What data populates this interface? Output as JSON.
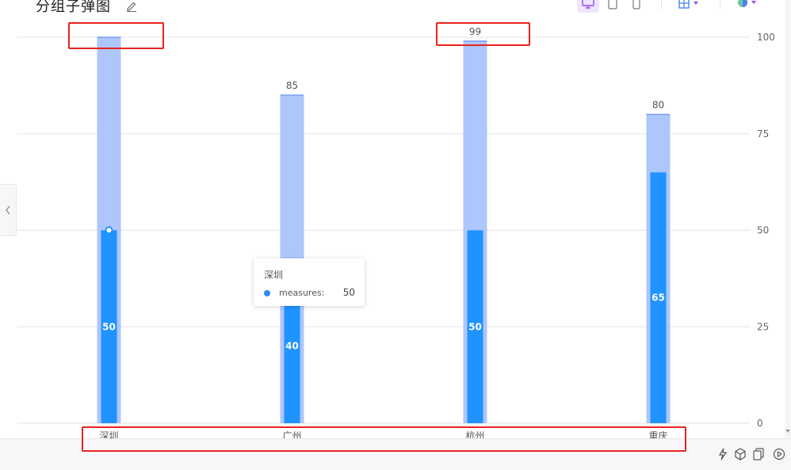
{
  "title": "分组子弹图",
  "toolbar": {
    "icons": [
      "desktop-icon",
      "tablet-icon",
      "mobile-icon",
      "layout-grid-icon",
      "theme-palette-icon"
    ],
    "accent": "#8f4ff0"
  },
  "tooltip": {
    "category": "深圳",
    "series": "measures:",
    "value": "50"
  },
  "colors": {
    "range": "#adc6fb",
    "measure": "#1f93ff",
    "grid": "#e3e3e3"
  },
  "chart_data": {
    "type": "bar",
    "subtype": "bullet",
    "categories": [
      "深圳",
      "广州",
      "杭州",
      "重庆"
    ],
    "series": [
      {
        "role": "range",
        "values": [
          100,
          85,
          99,
          80
        ]
      },
      {
        "role": "measure",
        "values": [
          50,
          40,
          50,
          65
        ]
      }
    ],
    "value_labels": {
      "range": [
        "",
        "85",
        "99",
        "80"
      ],
      "measure": [
        "50",
        "40",
        "50",
        "65"
      ]
    },
    "y_ticks": [
      "100",
      "75",
      "50",
      "25",
      "0"
    ],
    "ylim": [
      0,
      100
    ],
    "y_axis_side": "right",
    "grid": true
  }
}
